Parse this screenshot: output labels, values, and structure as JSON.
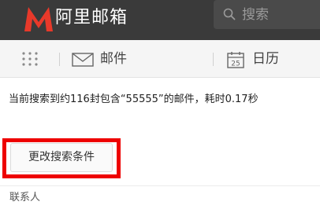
{
  "header": {
    "brand": "阿里邮箱",
    "search_placeholder": "搜索",
    "colors": {
      "background": "#3a3a3a",
      "logo": "#e8392a"
    }
  },
  "nav": {
    "apps_icon": "grid-icon",
    "mail_label": "邮件",
    "calendar_label": "日历",
    "calendar_day": "25"
  },
  "result": {
    "text": "当前搜索到约116封包含“55555”的邮件，耗时0.17秒"
  },
  "actions": {
    "modify_search_label": "更改搜索条件",
    "highlight_color": "#ee0000"
  },
  "sections": {
    "contacts_label": "联系人"
  }
}
